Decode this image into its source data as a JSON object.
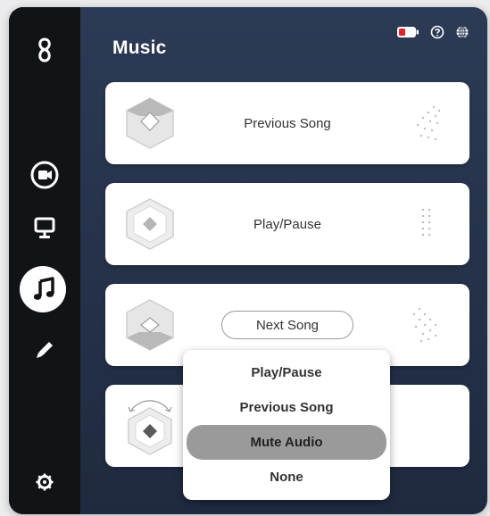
{
  "page": {
    "title": "Music"
  },
  "sidebar": {
    "items": [
      {
        "name": "logo",
        "icon": "link-logo-icon"
      },
      {
        "name": "camera",
        "icon": "camera-icon"
      },
      {
        "name": "presentation",
        "icon": "monitor-icon"
      },
      {
        "name": "music",
        "icon": "music-note-icon",
        "active": true
      },
      {
        "name": "edit",
        "icon": "pencil-icon"
      },
      {
        "name": "settings",
        "icon": "gear-icon"
      }
    ]
  },
  "header_icons": [
    "battery-icon",
    "help-icon",
    "globe-icon"
  ],
  "cards": [
    {
      "label": "Previous Song"
    },
    {
      "label": "Play/Pause"
    },
    {
      "label": "Next Song"
    },
    {
      "label": ""
    }
  ],
  "dropdown": {
    "options": [
      "Play/Pause",
      "Previous Song",
      "Mute Audio",
      "None"
    ],
    "selected": "Mute Audio"
  },
  "colors": {
    "sidebar_bg": "#111316",
    "main_bg": "#2c3a55",
    "card_bg": "#ffffff",
    "selected_option": "#9a9a9a",
    "battery_accent": "#e0242a"
  }
}
